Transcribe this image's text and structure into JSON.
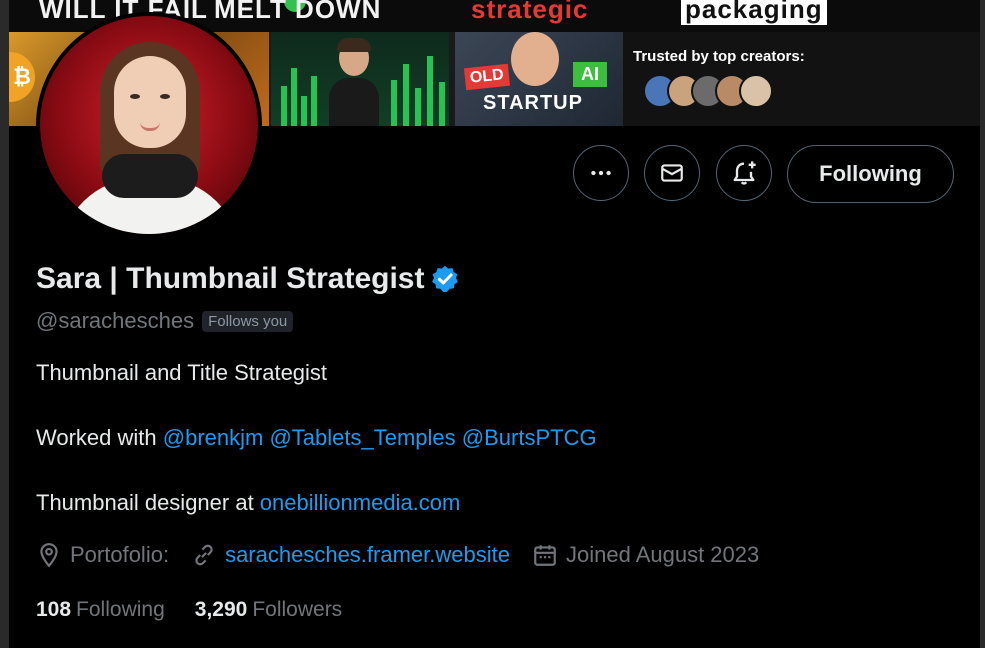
{
  "banner": {
    "text1": "WILL IT FAIL",
    "text2": "MELT DOWN",
    "text3": "strategic",
    "text4": "packaging",
    "old_label": "OLD",
    "ai_label": "AI",
    "startup_label": "STARTUP",
    "trusted_label": "Trusted by top creators:",
    "coin_symbol": "₿"
  },
  "actions": {
    "more_icon": "more-icon",
    "mail_icon": "mail-icon",
    "notify_icon": "notification-add-icon",
    "following_label": "Following"
  },
  "profile": {
    "name": "Sara | Thumbnail Strategist",
    "handle": "@sarachesches",
    "follows_you": "Follows you",
    "bio_line1": "Thumbnail and Title Strategist",
    "bio_line2_prefix": "Worked with ",
    "bio_mentions": [
      "@brenkjm",
      "@Tablets_Temples",
      "@BurtsPTCG"
    ],
    "bio_line3_prefix": "Thumbnail designer at ",
    "bio_line3_link": "onebillionmedia.com",
    "location": "Portofolio:",
    "website": "sarachesches.framer.website",
    "joined": "Joined August 2023",
    "following_count": "108",
    "following_label": "Following",
    "followers_count": "3,290",
    "followers_label": "Followers"
  },
  "colors": {
    "background": "#000000",
    "accent": "#1d9bf0",
    "muted": "#71767b",
    "text": "#e7e9ea",
    "verified": "#1d9bf0"
  }
}
